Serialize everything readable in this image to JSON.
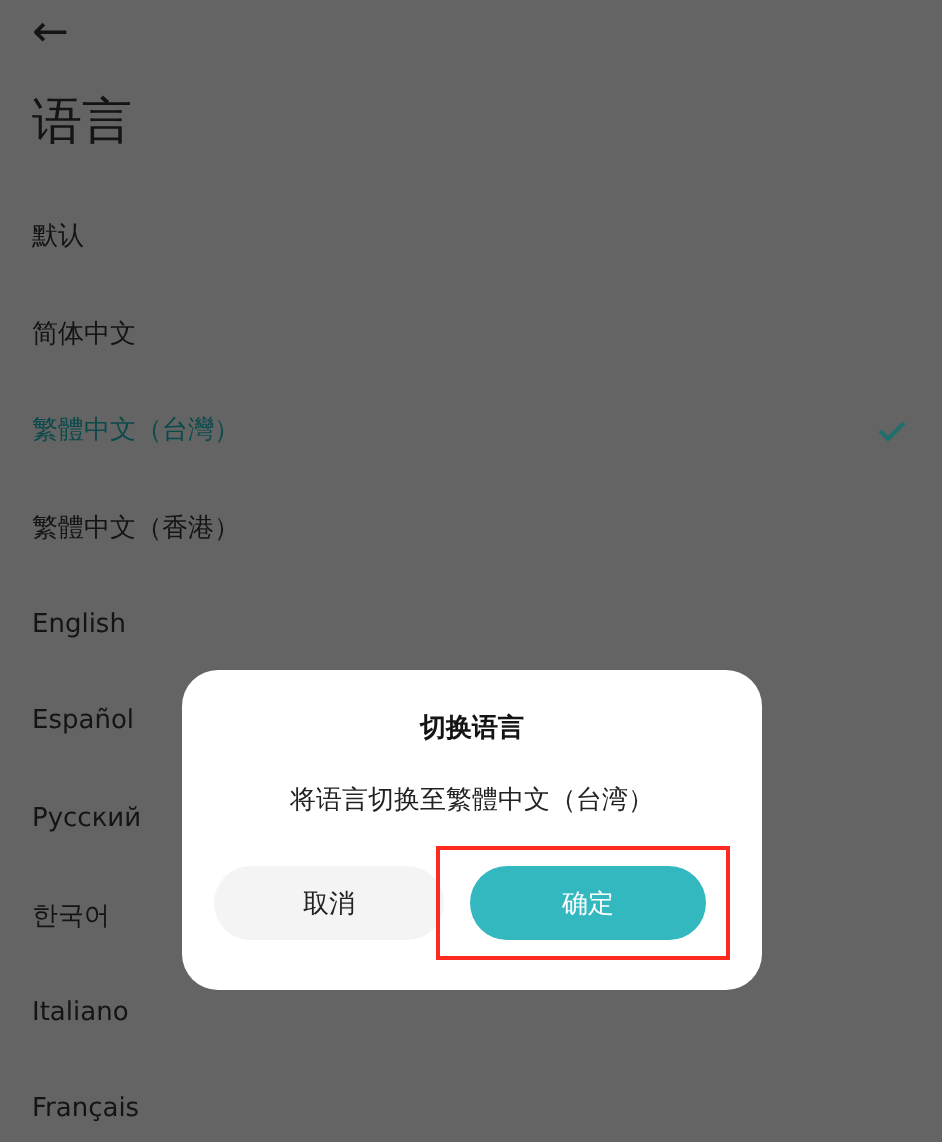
{
  "header": {
    "back_label": "←",
    "title": "语言"
  },
  "languages": [
    {
      "label": "默认",
      "selected": false
    },
    {
      "label": "简体中文",
      "selected": false
    },
    {
      "label": "繁體中文（台灣）",
      "selected": true
    },
    {
      "label": "繁體中文（香港）",
      "selected": false
    },
    {
      "label": "English",
      "selected": false
    },
    {
      "label": "Español",
      "selected": false
    },
    {
      "label": "Русский",
      "selected": false
    },
    {
      "label": "한국어",
      "selected": false
    },
    {
      "label": "Italiano",
      "selected": false
    },
    {
      "label": "Français",
      "selected": false
    }
  ],
  "dialog": {
    "title": "切换语言",
    "message": "将语言切换至繁體中文（台湾）",
    "buttons": [
      {
        "label": "取消",
        "kind": "cancel",
        "highlighted": false
      },
      {
        "label": "确定",
        "kind": "confirm",
        "highlighted": true
      }
    ]
  }
}
